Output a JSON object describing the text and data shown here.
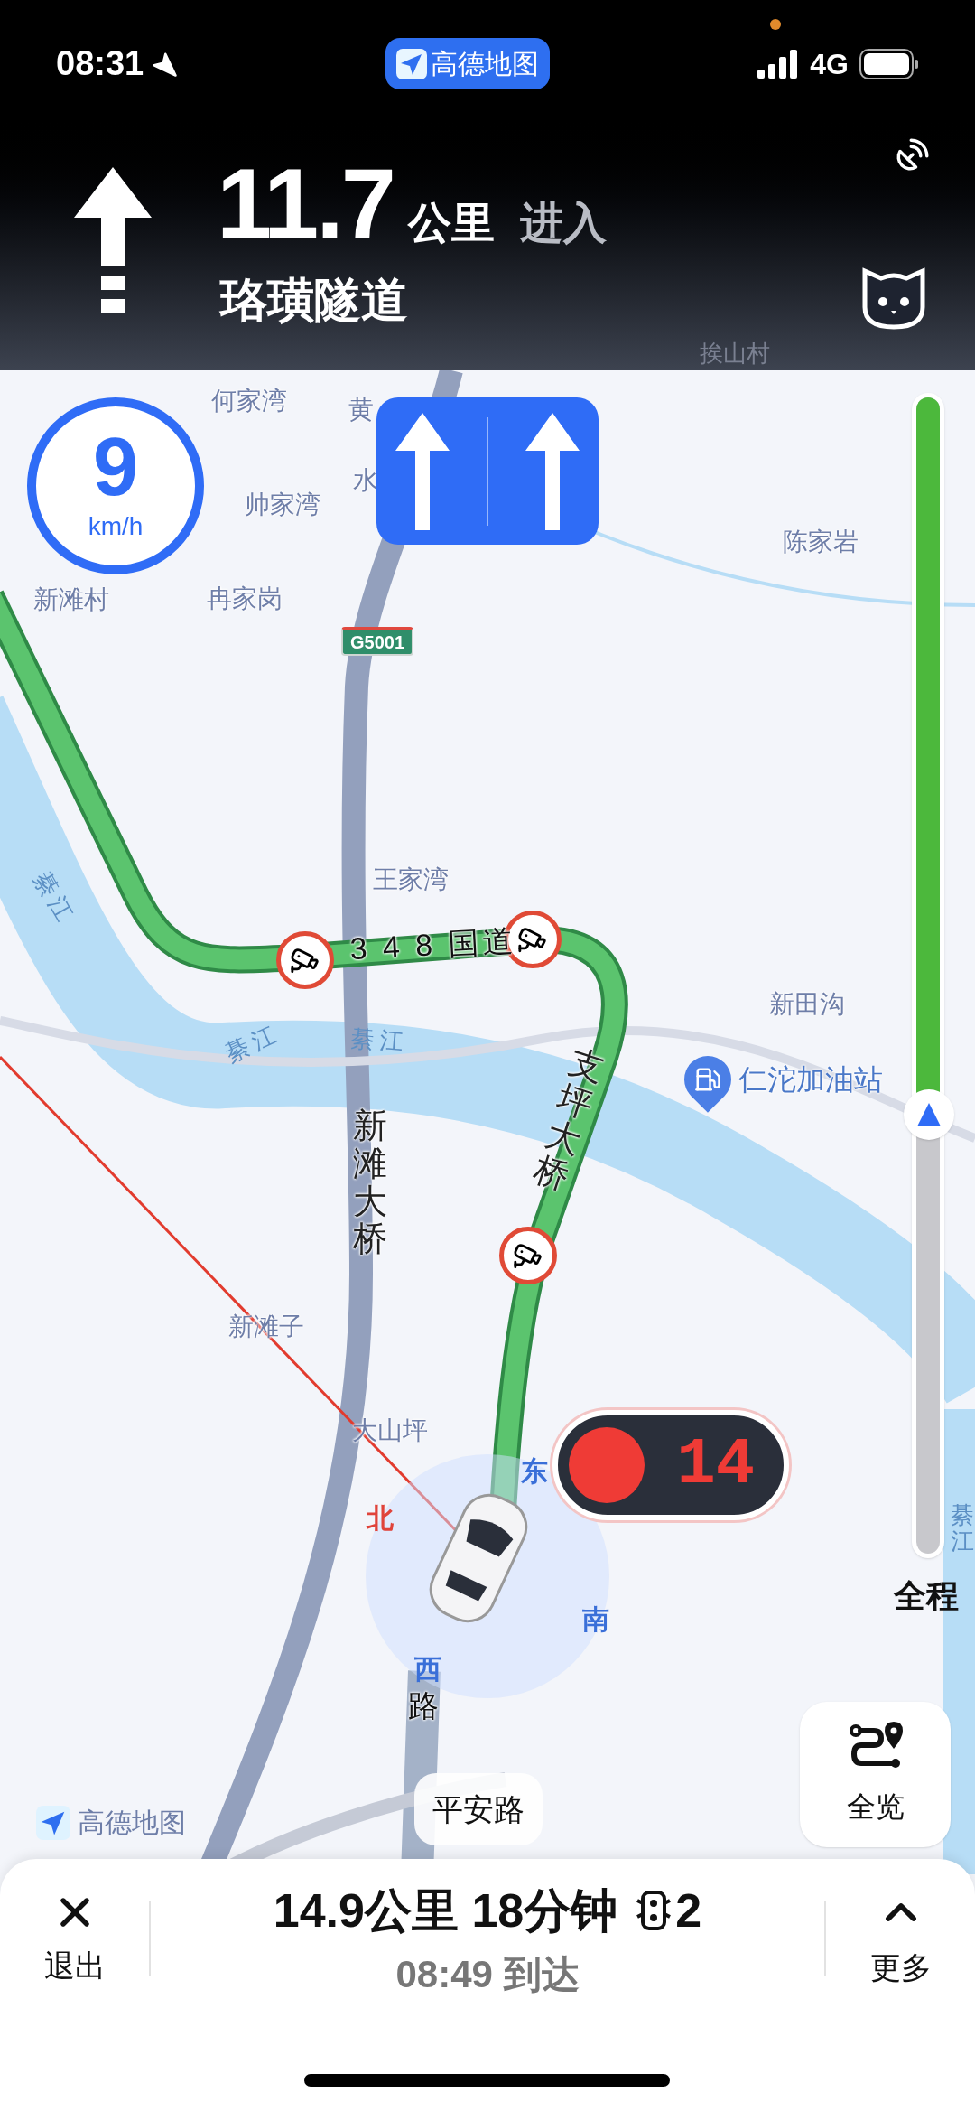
{
  "status_bar": {
    "time": "08:31",
    "app_pill": "高德地图",
    "network": "4G"
  },
  "guidance": {
    "distance": "11.7",
    "unit": "公里",
    "action": "进入",
    "road": "珞璜隧道"
  },
  "header_map_labels": [
    {
      "text": "挨山村"
    }
  ],
  "speed": {
    "value": "9",
    "unit": "km/h"
  },
  "lanes": [
    {
      "kind": "straight"
    },
    {
      "kind": "straight"
    }
  ],
  "map_labels": [
    {
      "text": "何家湾",
      "kind": "place"
    },
    {
      "text": "黄",
      "kind": "place"
    },
    {
      "text": "水",
      "kind": "place"
    },
    {
      "text": "帅家湾",
      "kind": "place"
    },
    {
      "text": "陈家岩",
      "kind": "place"
    },
    {
      "text": "新滩村",
      "kind": "place"
    },
    {
      "text": "冉家岗",
      "kind": "place"
    },
    {
      "text": "G5001",
      "kind": "shield"
    },
    {
      "text": "王家湾",
      "kind": "place"
    },
    {
      "text": "綦江",
      "kind": "water"
    },
    {
      "text": "3 4 8 国道",
      "kind": "road"
    },
    {
      "text": "新田沟",
      "kind": "place"
    },
    {
      "text": "仁沱加油站",
      "kind": "poi"
    },
    {
      "text": "綦江",
      "kind": "water"
    },
    {
      "text": "綦江",
      "kind": "water"
    },
    {
      "text": "新滩大桥",
      "kind": "road_vertical"
    },
    {
      "text": "支坪大桥",
      "kind": "road_vertical"
    },
    {
      "text": "新滩子",
      "kind": "place"
    },
    {
      "text": "大山坪",
      "kind": "place"
    },
    {
      "text": "北",
      "kind": "north"
    },
    {
      "text": "东",
      "kind": "compass"
    },
    {
      "text": "南",
      "kind": "compass"
    },
    {
      "text": "西",
      "kind": "compass"
    },
    {
      "text": "路",
      "kind": "road"
    },
    {
      "text": "綦江",
      "kind": "water_vertical"
    }
  ],
  "traffic_light": {
    "countdown": "14"
  },
  "progress": {
    "level": 0.62,
    "label": "全程"
  },
  "provider": "高德地图",
  "current_road": "平安路",
  "overview_button": "全览",
  "bottom_bar": {
    "exit": "退出",
    "summary": "14.9公里 18分钟",
    "lights": "2",
    "arrival": "08:49 到达",
    "more": "更多"
  }
}
